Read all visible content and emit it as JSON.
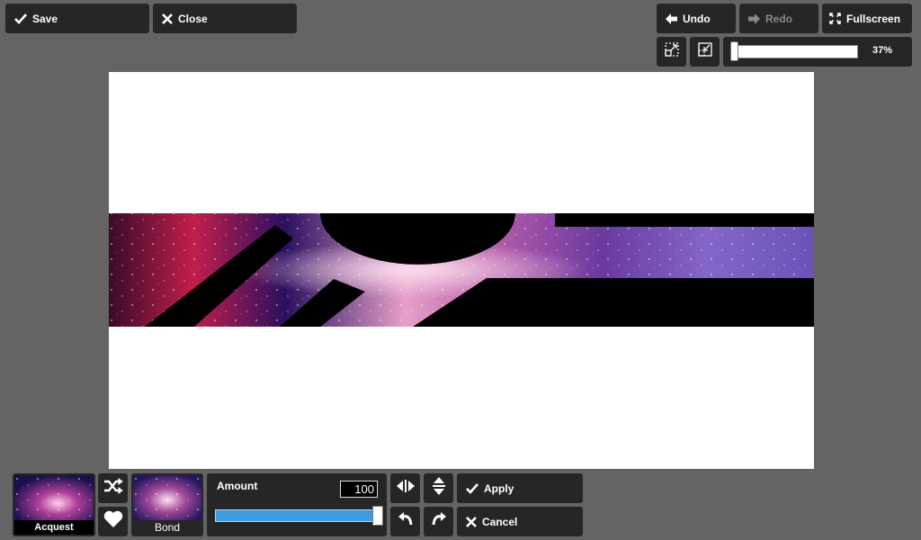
{
  "toolbar": {
    "save_label": "Save",
    "close_label": "Close",
    "undo_label": "Undo",
    "redo_label": "Redo",
    "fullscreen_label": "Fullscreen"
  },
  "zoom": {
    "percent_label": "37%",
    "level": 0.37
  },
  "bottom": {
    "presets": [
      {
        "label": "Acquest",
        "icon": "galaxy-thumbnail"
      },
      {
        "label": "Bond",
        "icon": "galaxy-thumbnail"
      }
    ],
    "amount_label": "Amount",
    "amount_value": "100",
    "amount_fraction": 1.0,
    "apply_label": "Apply",
    "cancel_label": "Cancel"
  },
  "colors": {
    "background": "#646464",
    "panel": "#262626",
    "slider_fill": "#3b9ce0"
  }
}
